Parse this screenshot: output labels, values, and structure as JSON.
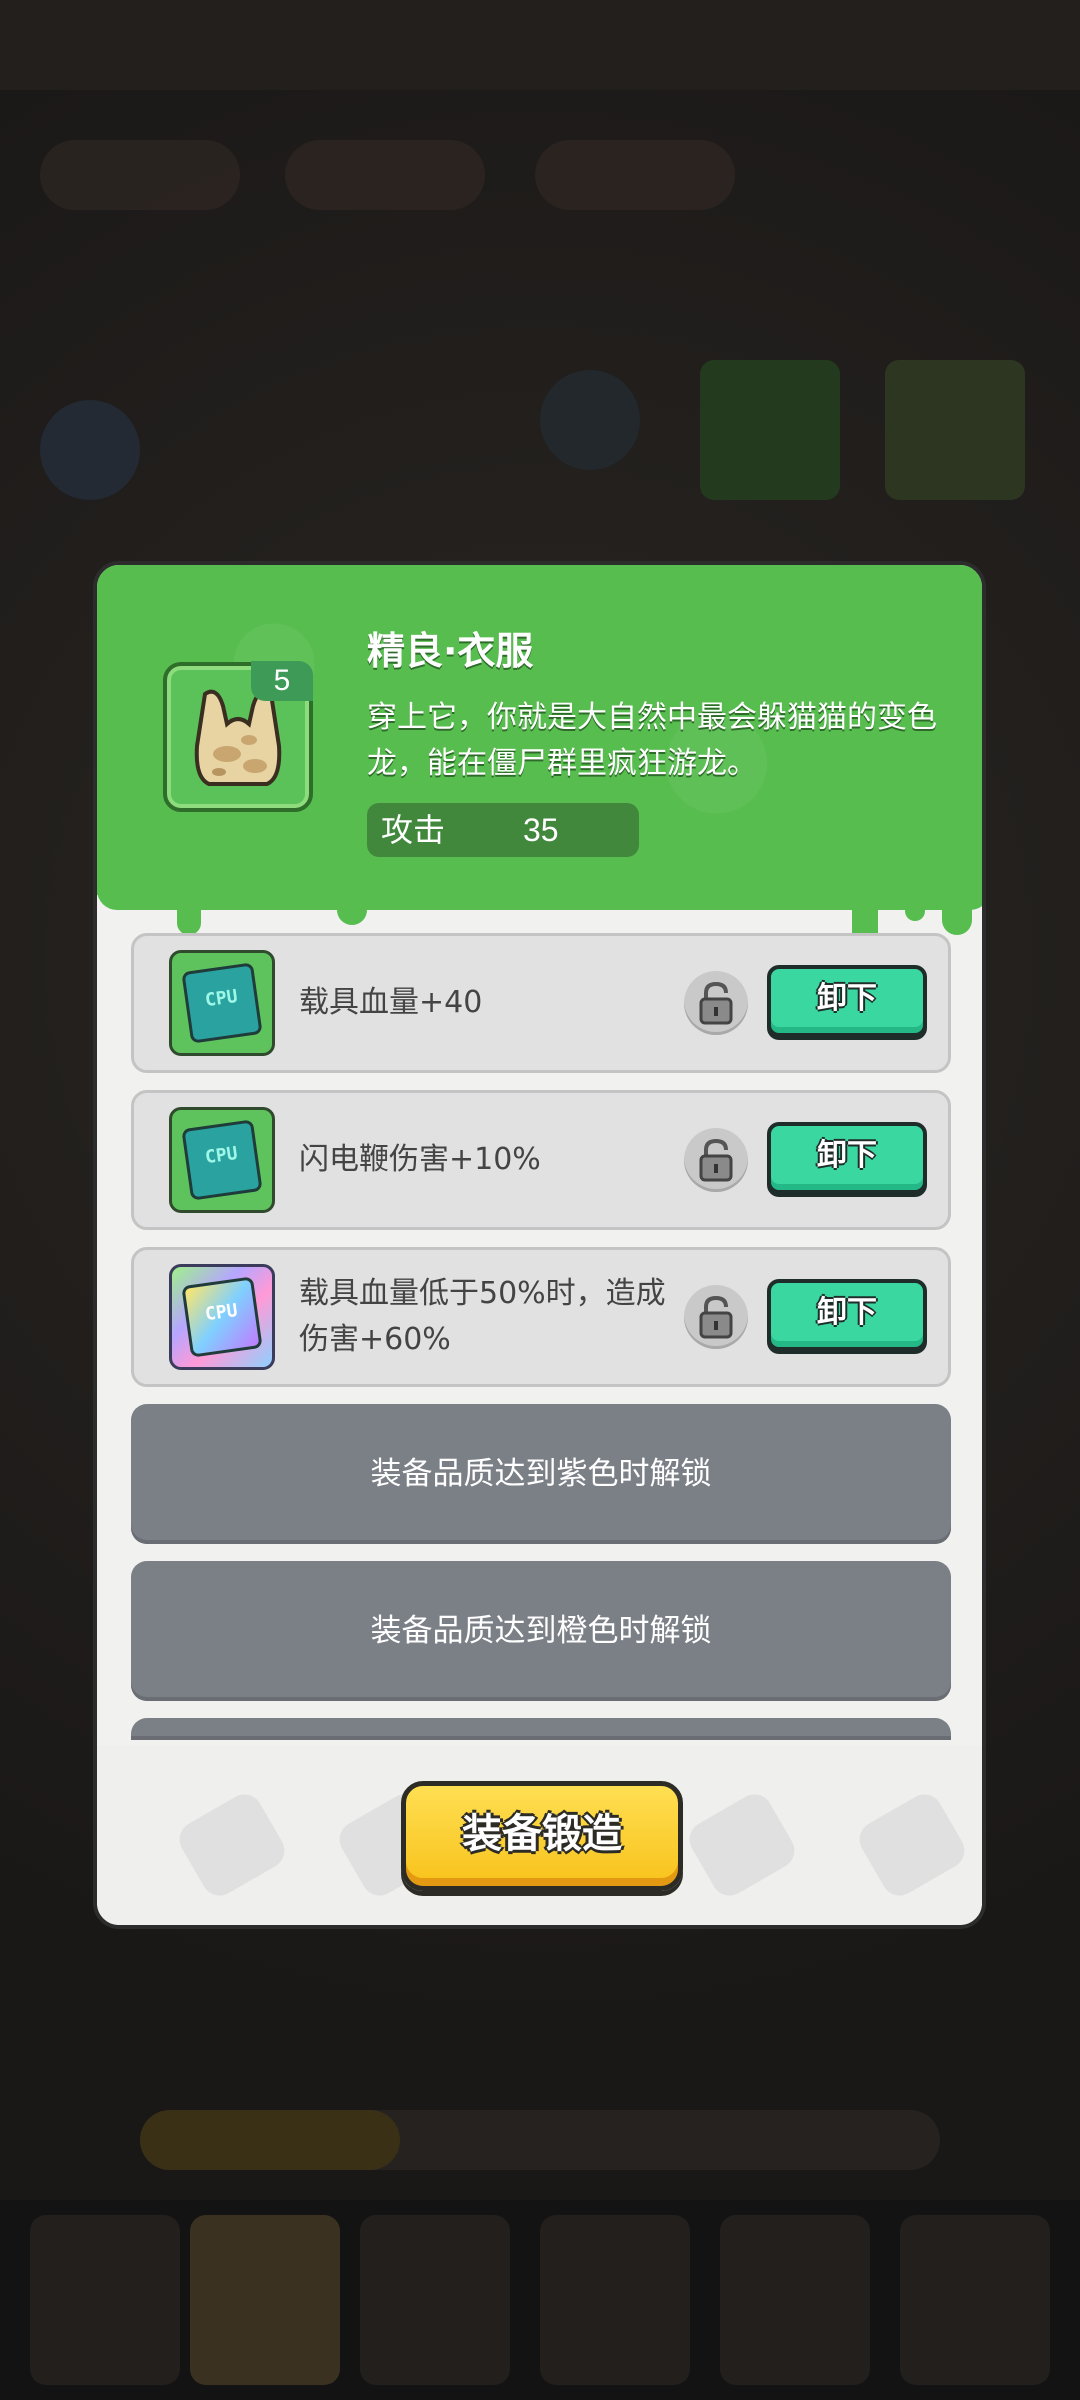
{
  "item": {
    "title": "精良·衣服",
    "level": "5",
    "description": "穿上它，你就是大自然中最会躲猫猫的变色龙，能在僵尸群里疯狂游龙。",
    "stat_label": "攻击",
    "stat_value": "35",
    "quality_color": "#57bd4f"
  },
  "affixes": [
    {
      "text": "载具血量+40",
      "chip_label": "CPU",
      "chip_style": "green",
      "button": "卸下",
      "icon": "unlocked-padlock-icon"
    },
    {
      "text": "闪电鞭伤害+10%",
      "chip_label": "CPU",
      "chip_style": "green",
      "button": "卸下",
      "icon": "unlocked-padlock-icon"
    },
    {
      "text": "载具血量低于50%时，造成伤害+60%",
      "chip_label": "CPU",
      "chip_style": "rainbow",
      "button": "卸下",
      "icon": "unlocked-padlock-icon"
    }
  ],
  "locked_slots": [
    "装备品质达到紫色时解锁",
    "装备品质达到橙色时解锁"
  ],
  "forge_button": "装备锻造",
  "colors": {
    "accent_green": "#57bd4f",
    "button_teal": "#3ad7a1",
    "forge_yellow": "#f8c21b",
    "locked_gray": "#7b7f86"
  }
}
